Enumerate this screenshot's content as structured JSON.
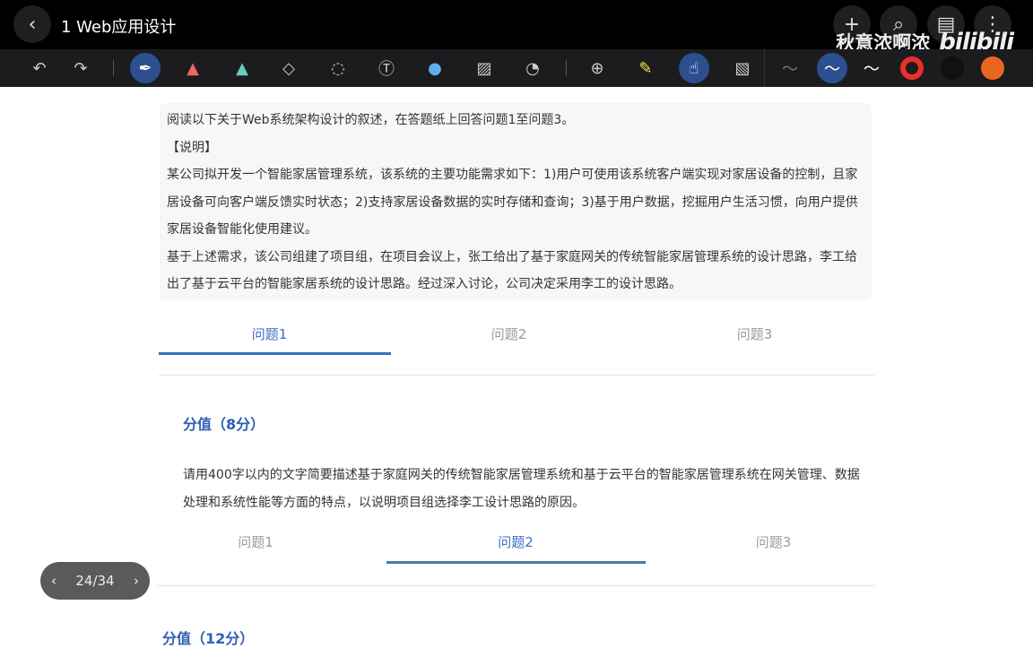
{
  "header": {
    "title": "1 Web应用设计",
    "back_icon": "chevron-left-icon",
    "actions": [
      "plus-icon",
      "search-icon",
      "layout-icon",
      "more-icon"
    ]
  },
  "watermark": {
    "author": "秋意浓啊浓",
    "logo": "bilibili"
  },
  "toolbar": {
    "tools": [
      "undo",
      "redo",
      "pen",
      "marker",
      "highlighter",
      "eraser",
      "lasso",
      "text",
      "shape",
      "image",
      "sticker",
      "zoom",
      "laser",
      "touch-off",
      "pattern"
    ],
    "pen_colors": [
      "#e8302b",
      "#111111",
      "#e8661e"
    ]
  },
  "intro": {
    "lines": [
      "阅读以下关于Web系统架构设计的叙述，在答题纸上回答问题1至问题3。",
      "【说明】",
      "某公司拟开发一个智能家居管理系统，该系统的主要功能需求如下：1)用户可使用该系统客户端实现对家居设备的控制，且家居设备可向客户端反馈实时状态；2)支持家居设备数据的实时存储和查询；3)基于用户数据，挖掘用户生活习惯，向用户提供家居设备智能化使用建议。",
      "基于上述需求，该公司组建了项目组，在项目会议上，张工给出了基于家庭网关的传统智能家居管理系统的设计思路，李工给出了基于云平台的智能家居系统的设计思路。经过深入讨论，公司决定采用李工的设计思路。"
    ]
  },
  "tabs1": [
    "问题1",
    "问题2",
    "问题3"
  ],
  "q1": {
    "score": "分值（8分）",
    "text": "请用400字以内的文字简要描述基于家庭网关的传统智能家居管理系统和基于云平台的智能家居管理系统在网关管理、数据处理和系统性能等方面的特点，以说明项目组选择李工设计思路的原因。"
  },
  "tabs2": [
    "问题1",
    "问题2",
    "问题3"
  ],
  "q2": {
    "score": "分值（12分）"
  },
  "pager": {
    "label": "24/34"
  }
}
